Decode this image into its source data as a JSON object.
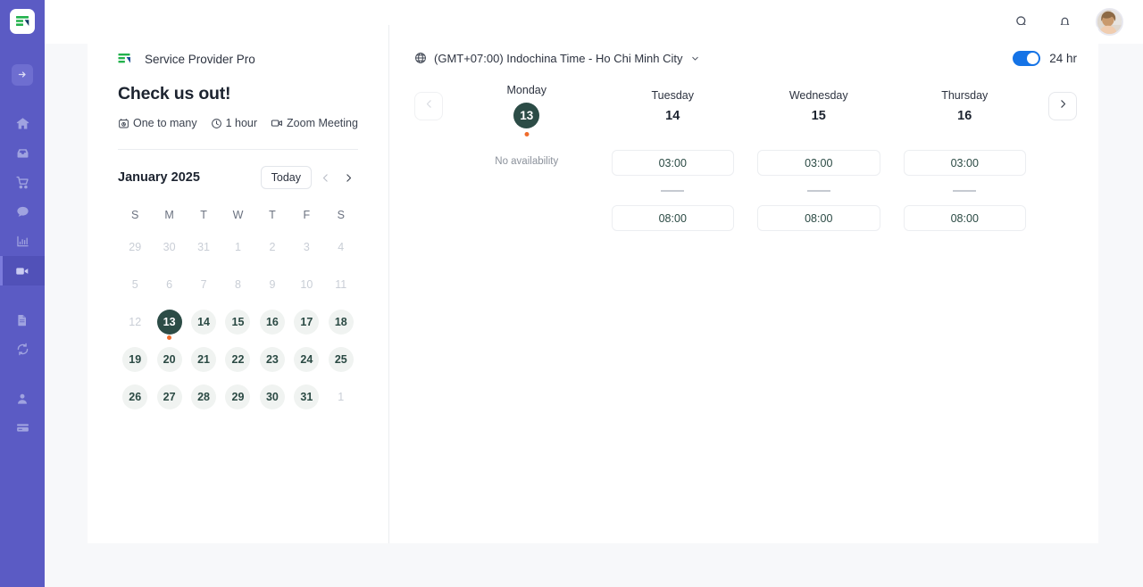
{
  "sidebar": {
    "logo_icon": "app-logo-icon",
    "items": [
      {
        "name": "collapse",
        "icon": "arrow-right-in-box-icon",
        "active": false,
        "badge": true
      },
      {
        "name": "home",
        "icon": "home-icon",
        "active": false
      },
      {
        "name": "inbox",
        "icon": "inbox-icon",
        "active": false
      },
      {
        "name": "store",
        "icon": "shopping-cart-icon",
        "active": false
      },
      {
        "name": "messages",
        "icon": "chat-bubble-icon",
        "active": false
      },
      {
        "name": "analytics",
        "icon": "bar-chart-icon",
        "active": false
      },
      {
        "name": "meetings",
        "icon": "video-camera-icon",
        "active": true
      },
      {
        "name": "documents",
        "icon": "document-icon",
        "active": false
      },
      {
        "name": "sync",
        "icon": "refresh-icon",
        "active": false
      },
      {
        "name": "contacts",
        "icon": "person-icon",
        "active": false
      },
      {
        "name": "billing",
        "icon": "credit-card-icon",
        "active": false
      }
    ]
  },
  "topbar": {
    "search_icon": "search-icon",
    "notifications_icon": "bell-icon",
    "avatar": "user-avatar"
  },
  "booking": {
    "brand_name": "Service Provider Pro",
    "brand_logo_icon": "service-provider-pro-logo",
    "event_title": "Check us out!",
    "meta": [
      {
        "icon": "one-to-many-icon",
        "label": "One to many"
      },
      {
        "icon": "clock-icon",
        "label": "1 hour"
      },
      {
        "icon": "video-camera-icon",
        "label": "Zoom Meeting"
      }
    ]
  },
  "calendar": {
    "month_label": "January 2025",
    "today_label": "Today",
    "prev_icon": "chevron-left-icon",
    "next_icon": "chevron-right-icon",
    "day_initials": [
      "S",
      "M",
      "T",
      "W",
      "T",
      "F",
      "S"
    ],
    "weeks": [
      [
        {
          "label": "29",
          "state": "muted"
        },
        {
          "label": "30",
          "state": "muted"
        },
        {
          "label": "31",
          "state": "muted"
        },
        {
          "label": "1",
          "state": "muted"
        },
        {
          "label": "2",
          "state": "muted"
        },
        {
          "label": "3",
          "state": "muted"
        },
        {
          "label": "4",
          "state": "muted"
        }
      ],
      [
        {
          "label": "5",
          "state": "muted"
        },
        {
          "label": "6",
          "state": "muted"
        },
        {
          "label": "7",
          "state": "muted"
        },
        {
          "label": "8",
          "state": "muted"
        },
        {
          "label": "9",
          "state": "muted"
        },
        {
          "label": "10",
          "state": "muted"
        },
        {
          "label": "11",
          "state": "muted"
        }
      ],
      [
        {
          "label": "12",
          "state": "muted"
        },
        {
          "label": "13",
          "state": "selected",
          "dot": true
        },
        {
          "label": "14",
          "state": "avail"
        },
        {
          "label": "15",
          "state": "avail"
        },
        {
          "label": "16",
          "state": "avail"
        },
        {
          "label": "17",
          "state": "avail"
        },
        {
          "label": "18",
          "state": "avail"
        }
      ],
      [
        {
          "label": "19",
          "state": "avail"
        },
        {
          "label": "20",
          "state": "avail"
        },
        {
          "label": "21",
          "state": "avail"
        },
        {
          "label": "22",
          "state": "avail"
        },
        {
          "label": "23",
          "state": "avail"
        },
        {
          "label": "24",
          "state": "avail"
        },
        {
          "label": "25",
          "state": "avail"
        }
      ],
      [
        {
          "label": "26",
          "state": "avail"
        },
        {
          "label": "27",
          "state": "avail"
        },
        {
          "label": "28",
          "state": "avail"
        },
        {
          "label": "29",
          "state": "avail"
        },
        {
          "label": "30",
          "state": "avail"
        },
        {
          "label": "31",
          "state": "avail"
        },
        {
          "label": "1",
          "state": "muted"
        }
      ]
    ]
  },
  "schedule": {
    "timezone_label": "(GMT+07:00) Indochina Time - Ho Chi Minh City",
    "timezone_icon": "globe-icon",
    "timezone_caret": "chevron-down-icon",
    "hour_format_label": "24 hr",
    "hour_format_on": true,
    "prev_week_icon": "chevron-left-icon",
    "next_week_icon": "chevron-right-icon",
    "no_availability_label": "No availability",
    "columns": [
      {
        "day_name": "Monday",
        "day_number": "13",
        "selected": true,
        "has_dot": true,
        "available": false,
        "slots": []
      },
      {
        "day_name": "Tuesday",
        "day_number": "14",
        "selected": false,
        "has_dot": false,
        "available": true,
        "slots": [
          "03:00",
          "08:00"
        ]
      },
      {
        "day_name": "Wednesday",
        "day_number": "15",
        "selected": false,
        "has_dot": false,
        "available": true,
        "slots": [
          "03:00",
          "08:00"
        ]
      },
      {
        "day_name": "Thursday",
        "day_number": "16",
        "selected": false,
        "has_dot": false,
        "available": true,
        "slots": [
          "03:00",
          "08:00"
        ]
      }
    ]
  },
  "colors": {
    "rail_bg": "#5b5bc4",
    "rail_active": "#5151b8",
    "accent_dark_green": "#2c4c46",
    "dot_orange": "#ef6c2c",
    "toggle_blue": "#1573e6",
    "page_bg": "#f7f8fa"
  }
}
